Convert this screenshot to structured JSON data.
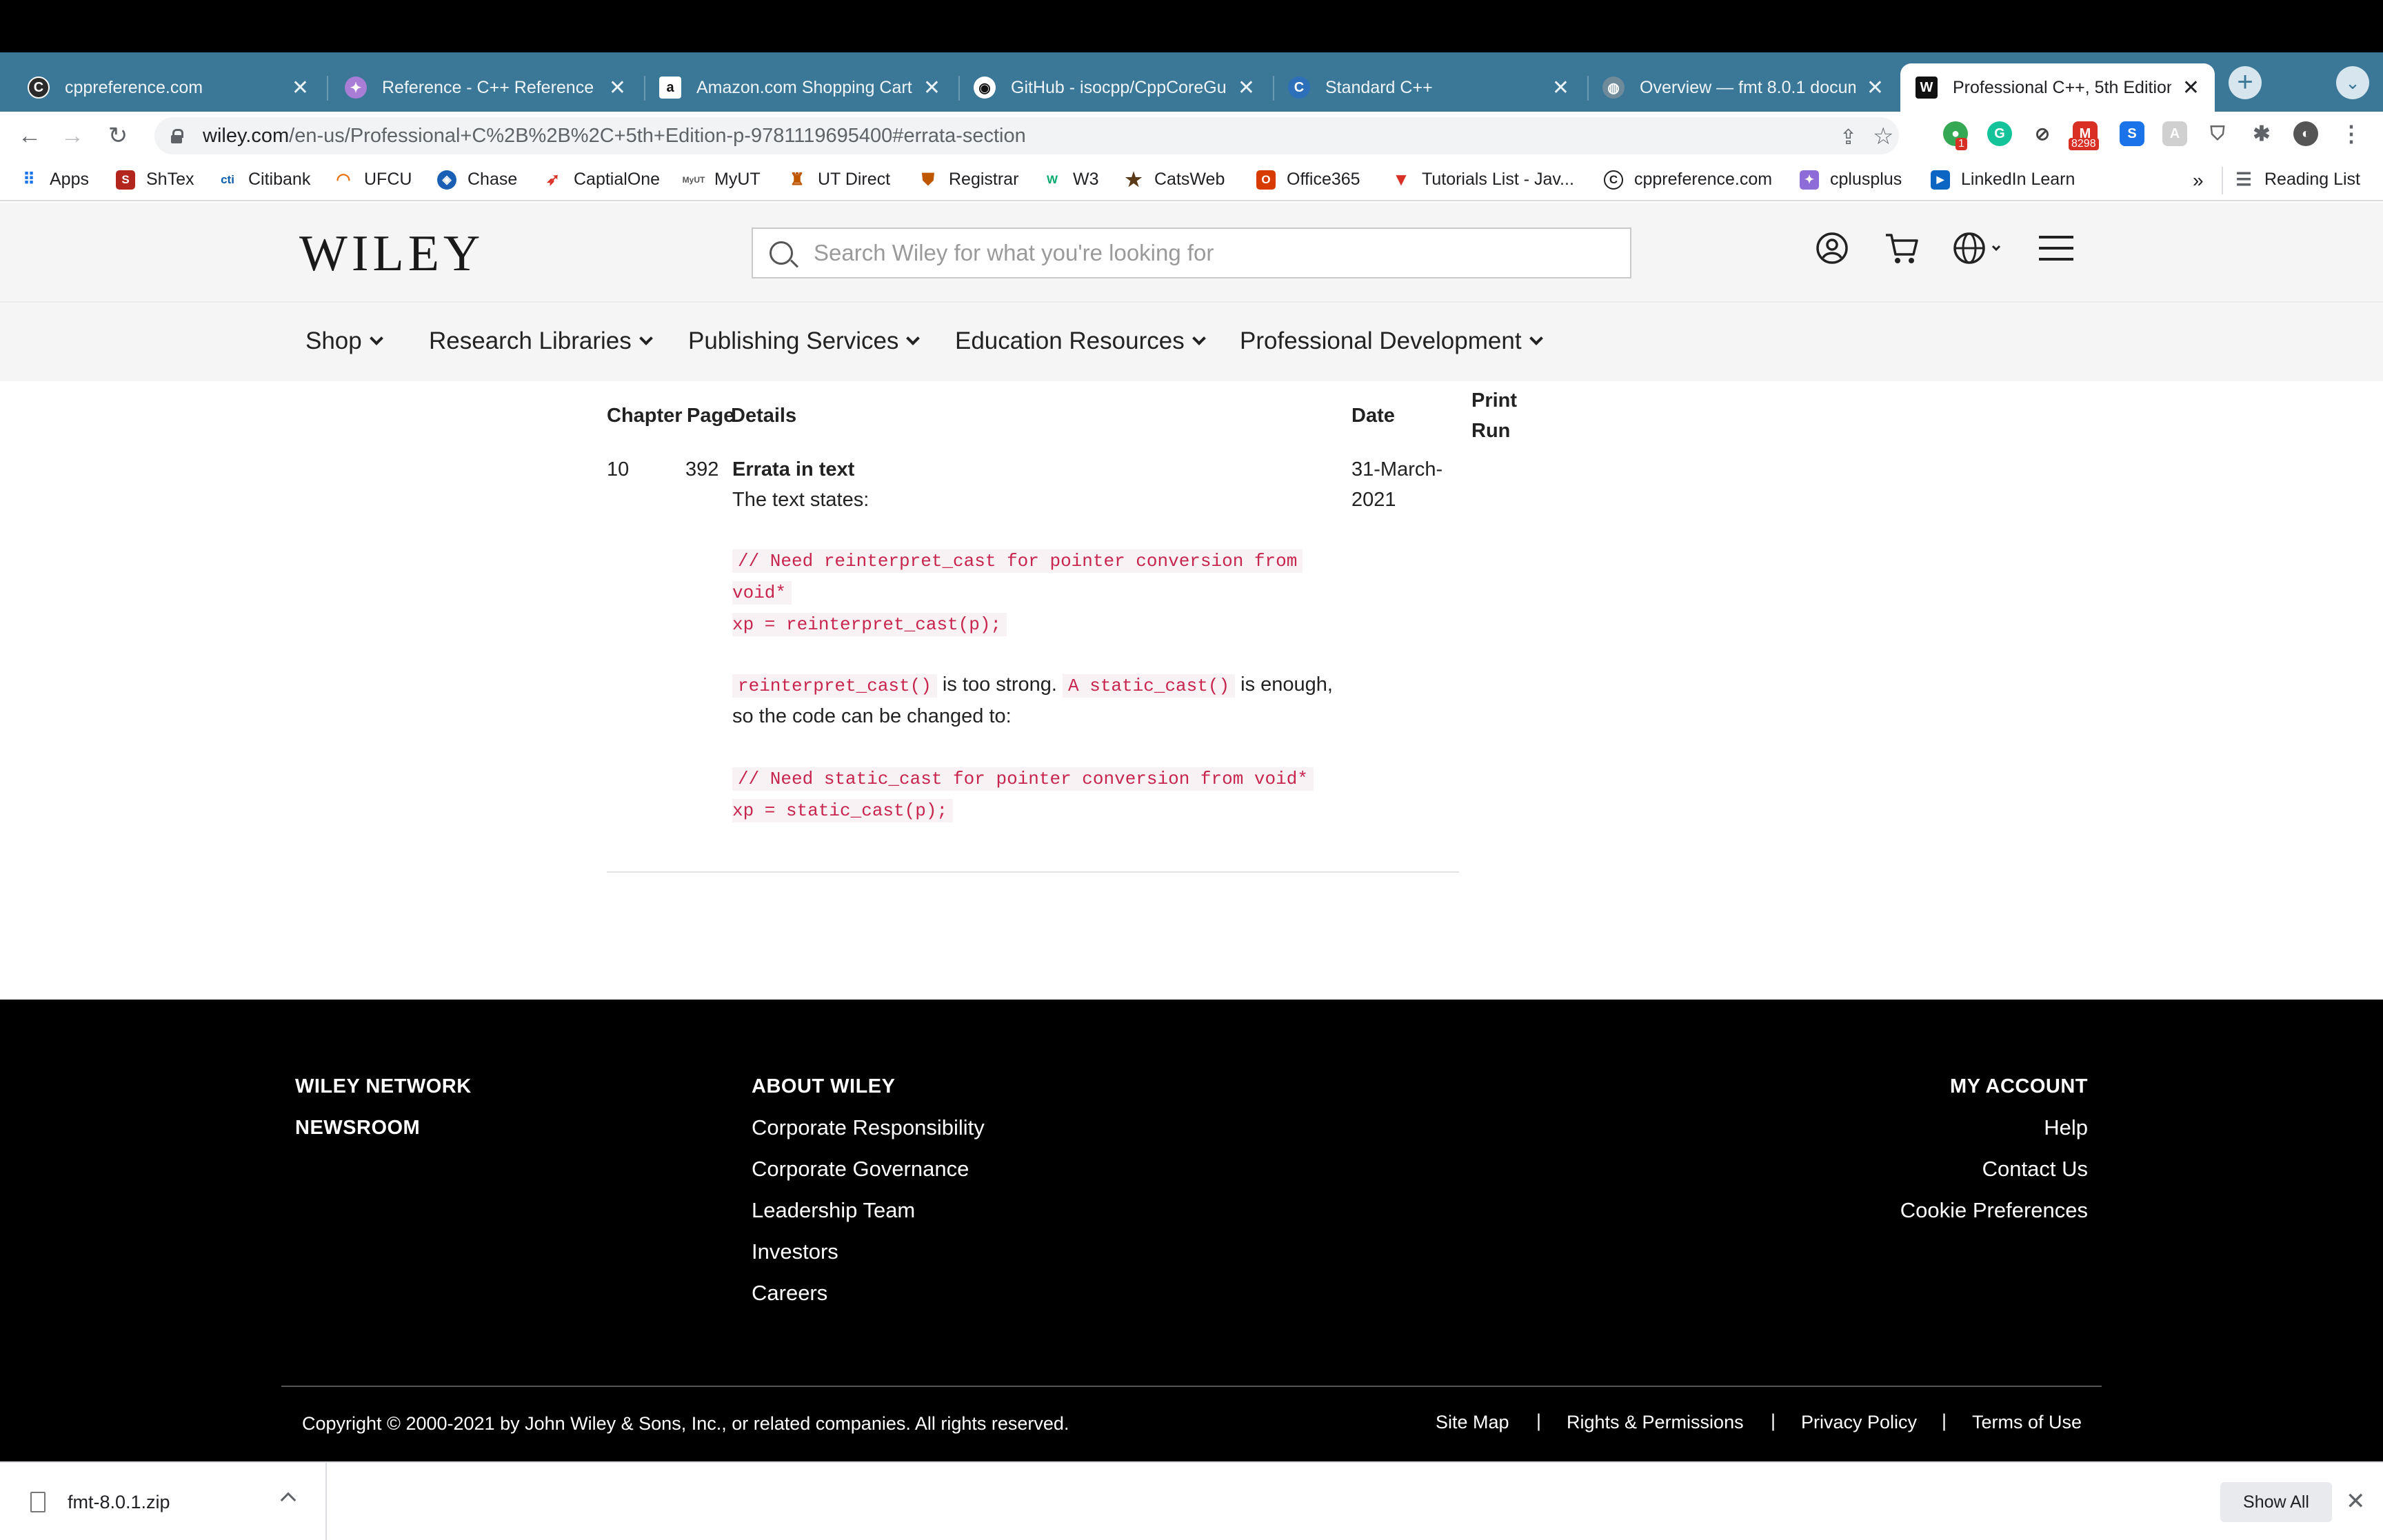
{
  "browser": {
    "tabs": [
      {
        "title": "cppreference.com",
        "icon": "cppreference-favicon",
        "active": false
      },
      {
        "title": "Reference - C++ Reference",
        "icon": "cplusplus-favicon",
        "active": false
      },
      {
        "title": "Amazon.com Shopping Cart",
        "icon": "amazon-favicon",
        "active": false
      },
      {
        "title": "GitHub - isocpp/CppCoreGui",
        "icon": "github-favicon",
        "active": false
      },
      {
        "title": "Standard C++",
        "icon": "isocpp-favicon",
        "active": false
      },
      {
        "title": "Overview — fmt 8.0.1 docum",
        "icon": "globe-favicon",
        "active": false
      },
      {
        "title": "Professional C++, 5th Edition",
        "icon": "wiley-favicon",
        "active": true
      }
    ],
    "new_tab_glyph": "+",
    "tab_close_glyph": "✕",
    "url_domain": "wiley.com",
    "url_path": "/en-us/Professional+C%2B%2B%2C+5th+Edition-p-9781119695400#errata-section",
    "extension_badges": {
      "first": "1",
      "gmail": "8298"
    },
    "bookmarks": [
      {
        "label": "Apps",
        "icon": "apps-grid-icon"
      },
      {
        "label": "ShTex",
        "icon": "shtex-icon"
      },
      {
        "label": "Citibank",
        "icon": "citibank-icon"
      },
      {
        "label": "UFCU",
        "icon": "ufcu-icon"
      },
      {
        "label": "Chase",
        "icon": "chase-icon"
      },
      {
        "label": "CaptialOne",
        "icon": "capitalone-icon"
      },
      {
        "label": "MyUT",
        "icon": "myut-icon"
      },
      {
        "label": "UT Direct",
        "icon": "ut-tower-icon"
      },
      {
        "label": "Registrar",
        "icon": "registrar-shield-icon"
      },
      {
        "label": "W3",
        "icon": "w3-icon"
      },
      {
        "label": "CatsWeb",
        "icon": "star-icon"
      },
      {
        "label": "Office365",
        "icon": "office-icon"
      },
      {
        "label": "Tutorials List - Jav...",
        "icon": "tutorials-icon"
      },
      {
        "label": "cppreference.com",
        "icon": "cppreference-icon"
      },
      {
        "label": "cplusplus",
        "icon": "cplusplus-icon"
      },
      {
        "label": "LinkedIn Learn",
        "icon": "linkedin-icon"
      }
    ],
    "bookmarks_overflow": "»",
    "reading_list": "Reading List"
  },
  "wiley": {
    "logo": "WILEY",
    "search_placeholder": "Search Wiley for what you're looking for",
    "nav": [
      "Shop",
      "Research Libraries",
      "Publishing Services",
      "Education Resources",
      "Professional Development"
    ]
  },
  "errata": {
    "headers": {
      "chapter": "Chapter",
      "page": "Page",
      "details": "Details",
      "date": "Date",
      "print_run_line1": "Print",
      "print_run_line2": "Run"
    },
    "row": {
      "chapter": "10",
      "page": "392",
      "title": "Errata in text",
      "intro": "The text states:",
      "code1_line1": "// Need reinterpret_cast for pointer conversion from",
      "code1_line2": "void*",
      "code1_line3": "xp = reinterpret_cast(p);",
      "inline_code_a": "reinterpret_cast()",
      "text_mid_a": "is too strong.",
      "inline_code_b": "A static_cast()",
      "text_mid_b": "is enough,",
      "text_line2": "so the code can be changed to:",
      "code2_line1": "// Need static_cast for pointer conversion from void*",
      "code2_line2": "xp = static_cast(p);",
      "date_line1": "31-March-",
      "date_line2": "2021"
    }
  },
  "footer": {
    "network": [
      "WILEY NETWORK",
      "NEWSROOM"
    ],
    "about_heading": "ABOUT WILEY",
    "about_links": [
      "Corporate Responsibility",
      "Corporate Governance",
      "Leadership Team",
      "Investors",
      "Careers"
    ],
    "account_heading": "MY ACCOUNT",
    "account_links": [
      "Help",
      "Contact Us",
      "Cookie Preferences"
    ],
    "copyright": "Copyright © 2000-2021 by John Wiley & Sons, Inc., or related companies. All rights reserved.",
    "legal_links": [
      "Site Map",
      "Rights & Permissions",
      "Privacy Policy",
      "Terms of Use"
    ],
    "legal_separator": "|"
  },
  "downloads": {
    "file": "fmt-8.0.1.zip",
    "show_all": "Show All",
    "close_glyph": "✕"
  }
}
